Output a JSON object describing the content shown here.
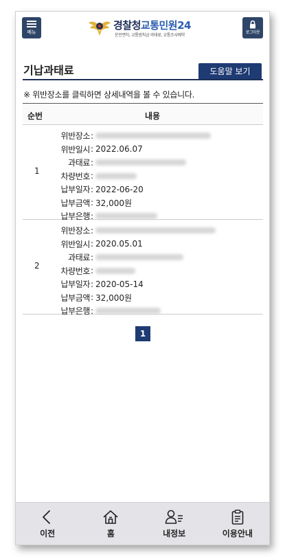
{
  "header": {
    "menu_label": "메뉴",
    "logo_title_1": "경찰청",
    "logo_title_2": "교통민원24",
    "logo_sub": "운전면허, 교통범칙금·과태료, 교통조사예약",
    "logout_label": "로그아웃"
  },
  "page": {
    "title": "기납과태료",
    "help_label": "도움말 보기",
    "notice": "※ 위반장소를 클릭하면 상세내역을 볼 수 있습니다."
  },
  "table": {
    "headers": [
      "순번",
      "내용"
    ],
    "rows": [
      {
        "num": "1",
        "fields": [
          {
            "label": "위반장소",
            "value": ""
          },
          {
            "label": "위반일시",
            "value": "2022.06.07"
          },
          {
            "label": "과태료",
            "value": ""
          },
          {
            "label": "차량번호",
            "value": ""
          },
          {
            "label": "납부일자",
            "value": "2022-06-20"
          },
          {
            "label": "납부금액",
            "value": "32,000원"
          },
          {
            "label": "납부은행",
            "value": ""
          }
        ]
      },
      {
        "num": "2",
        "fields": [
          {
            "label": "위반장소",
            "value": ""
          },
          {
            "label": "위반일시",
            "value": "2020.05.01"
          },
          {
            "label": "과태료",
            "value": ""
          },
          {
            "label": "차량번호",
            "value": ""
          },
          {
            "label": "납부일자",
            "value": "2020-05-14"
          },
          {
            "label": "납부금액",
            "value": "32,000원"
          },
          {
            "label": "납부은행",
            "value": ""
          }
        ]
      }
    ]
  },
  "pagination": {
    "current": "1"
  },
  "bottom_nav": [
    {
      "label": "이전",
      "icon": "back-arrow-icon"
    },
    {
      "label": "홈",
      "icon": "home-icon"
    },
    {
      "label": "내정보",
      "icon": "user-info-icon"
    },
    {
      "label": "이용안내",
      "icon": "clipboard-icon"
    }
  ],
  "colors": {
    "primary": "#1f3b73",
    "header_btn": "#2e4567",
    "logo_gold": "#e1b23a",
    "nav_bg": "#e4e4e8"
  }
}
